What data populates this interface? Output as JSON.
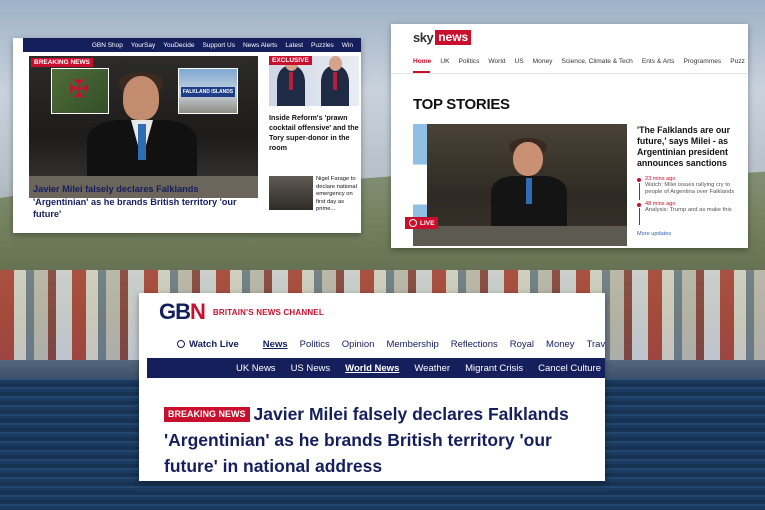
{
  "gbn_top": {
    "nav": [
      "GBN Shop",
      "YourSay",
      "YouDecide",
      "Support Us",
      "News Alerts",
      "Latest",
      "Puzzles",
      "Win"
    ],
    "breaking_badge": "BREAKING NEWS",
    "inset_sign": "FALKLAND ISLANDS",
    "headline": "Javier Milei falsely declares Falklands 'Argentinian' as he brands British territory 'our future'",
    "exclusive_badge": "EXCLUSIVE",
    "side_story_1": "Inside Reform's 'prawn cocktail offensive' and the Tory super-donor in the room",
    "side_story_2": "Nigel Farage to declare national emergency on first day as prime..."
  },
  "sky": {
    "logo_sky": "sky",
    "logo_news": "news",
    "nav": [
      "Home",
      "UK",
      "Politics",
      "World",
      "US",
      "Money",
      "Science, Climate & Tech",
      "Ents & Arts",
      "Programmes",
      "Puzz"
    ],
    "section_title": "TOP STORIES",
    "live_label": "LIVE",
    "headline": "'The Falklands are our future,' says Milei - as Argentinian president announces sanctions",
    "updates": [
      {
        "time": "23 mins ago",
        "text": "Watch: Milei issues rallying cry to people of Argentina over Falklands"
      },
      {
        "time": "48 mins ago",
        "text": "Analysis: Trump and as make this"
      }
    ],
    "more": "More updates"
  },
  "gbn_bottom": {
    "logo": "GB",
    "logo_letter": "N",
    "tagline": "BRITAIN'S NEWS CHANNEL",
    "watch_live": "Watch Live",
    "nav": [
      "News",
      "Politics",
      "Opinion",
      "Membership",
      "Reflections",
      "Royal",
      "Money",
      "Travel"
    ],
    "subnav": [
      "UK News",
      "US News",
      "World News",
      "Weather",
      "Migrant Crisis",
      "Cancel Culture"
    ],
    "breaking_badge": "BREAKING NEWS",
    "headline": "Javier Milei falsely declares Falklands 'Argentinian' as he brands British territory 'our future' in national address"
  },
  "colors": {
    "gbn_navy": "#151f5c",
    "gbn_red": "#c8102e",
    "sky_red": "#c8102e"
  },
  "icons": [
    "menu-icon",
    "live-dot-icon",
    "globe-icon",
    "flag-icon"
  ]
}
